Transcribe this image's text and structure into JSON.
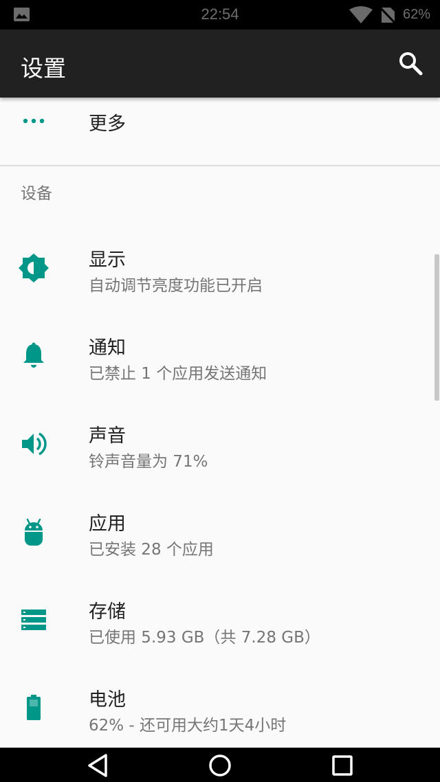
{
  "status_bar": {
    "time": "22:54",
    "battery": "62%",
    "icons": [
      "gallery-icon",
      "wifi-icon",
      "no-sim-icon"
    ]
  },
  "app_bar": {
    "title": "设置",
    "search_icon": "search-icon"
  },
  "accent_color": "#009688",
  "more_item": {
    "label": "更多",
    "icon": "more-horiz-icon"
  },
  "section": {
    "title": "设备"
  },
  "items": [
    {
      "label": "显示",
      "summary": "自动调节亮度功能已开启",
      "icon": "brightness-icon"
    },
    {
      "label": "通知",
      "summary": "已禁止 1 个应用发送通知",
      "icon": "bell-icon"
    },
    {
      "label": "声音",
      "summary": "铃声音量为 71%",
      "icon": "volume-icon"
    },
    {
      "label": "应用",
      "summary": "已安装 28 个应用",
      "icon": "android-icon"
    },
    {
      "label": "存储",
      "summary": "已使用 5.93 GB（共 7.28 GB）",
      "icon": "storage-icon"
    },
    {
      "label": "电池",
      "summary": "62% - 还可用大约1天4小时",
      "icon": "battery-icon"
    }
  ],
  "nav_bar": {
    "icons": [
      "back-icon",
      "home-icon",
      "recents-icon"
    ]
  }
}
